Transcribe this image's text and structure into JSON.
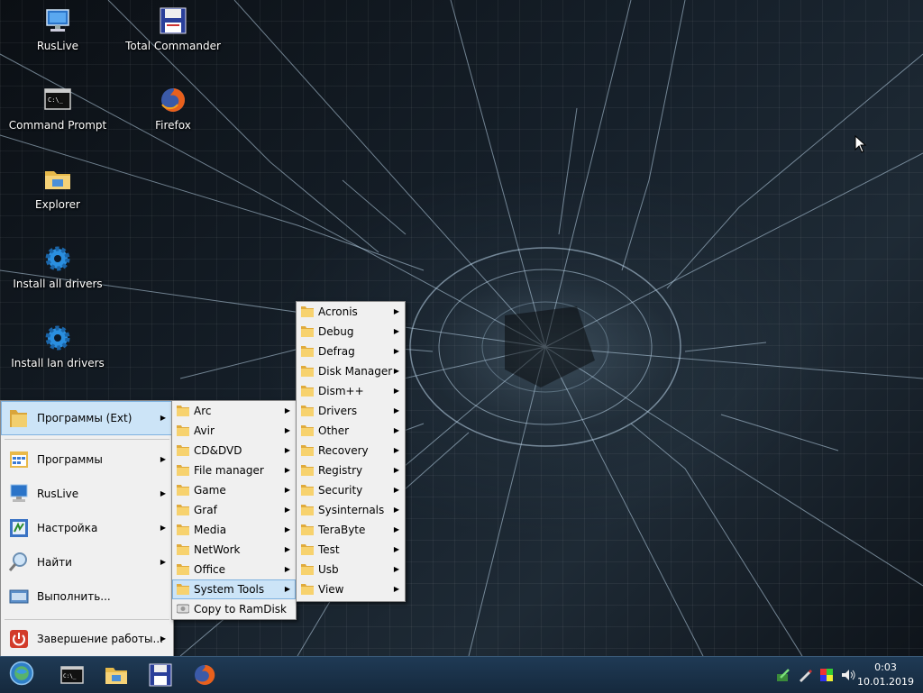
{
  "desktop": {
    "icons": [
      {
        "label": "RusLive",
        "icon": "computer-icon"
      },
      {
        "label": "Total Commander",
        "icon": "floppy-disk-icon"
      },
      {
        "label": "Command Prompt",
        "icon": "console-icon"
      },
      {
        "label": "Firefox",
        "icon": "firefox-icon"
      },
      {
        "label": "Explorer",
        "icon": "folder-icon"
      },
      {
        "label": "Install all drivers",
        "icon": "gear-icon"
      },
      {
        "label": "Install lan drivers",
        "icon": "gear-icon"
      }
    ]
  },
  "start_menu": {
    "items": [
      {
        "label": "Программы (Ext)",
        "icon": "folder-icon"
      },
      {
        "label": "Программы",
        "icon": "programs-icon"
      },
      {
        "label": "RusLive",
        "icon": "computer-icon"
      },
      {
        "label": "Настройка",
        "icon": "settings-icon"
      },
      {
        "label": "Найти",
        "icon": "magnifier-icon"
      },
      {
        "label": "Выполнить...",
        "icon": "run-icon"
      },
      {
        "label": "Завершение работы...",
        "icon": "shutdown-icon"
      }
    ]
  },
  "submenu_ext": {
    "items": [
      {
        "label": "Arc"
      },
      {
        "label": "Avir"
      },
      {
        "label": "CD&DVD"
      },
      {
        "label": "File manager"
      },
      {
        "label": "Game"
      },
      {
        "label": "Graf"
      },
      {
        "label": "Media"
      },
      {
        "label": "NetWork"
      },
      {
        "label": "Office"
      },
      {
        "label": "System Tools"
      },
      {
        "label": "Copy to RamDisk"
      }
    ]
  },
  "submenu_system_tools": {
    "items": [
      {
        "label": "Acronis"
      },
      {
        "label": "Debug"
      },
      {
        "label": "Defrag"
      },
      {
        "label": "Disk Manager"
      },
      {
        "label": "Dism++"
      },
      {
        "label": "Drivers"
      },
      {
        "label": "Other"
      },
      {
        "label": "Recovery"
      },
      {
        "label": "Registry"
      },
      {
        "label": "Security"
      },
      {
        "label": "Sysinternals"
      },
      {
        "label": "TeraByte"
      },
      {
        "label": "Test"
      },
      {
        "label": "Usb"
      },
      {
        "label": "View"
      }
    ]
  },
  "taskbar": {
    "start_icon": "start-orb-icon",
    "pinned": [
      "console-icon",
      "folder-icon",
      "floppy-disk-icon",
      "firefox-icon"
    ],
    "tray": [
      "network-icon",
      "pen-icon",
      "color-icon",
      "volume-icon"
    ],
    "time": "0:03",
    "date": "10.01.2019"
  },
  "colors": {
    "selection": "#cce4f7",
    "menu_bg": "#f0f0f0",
    "taskbar": "#1a3249"
  }
}
